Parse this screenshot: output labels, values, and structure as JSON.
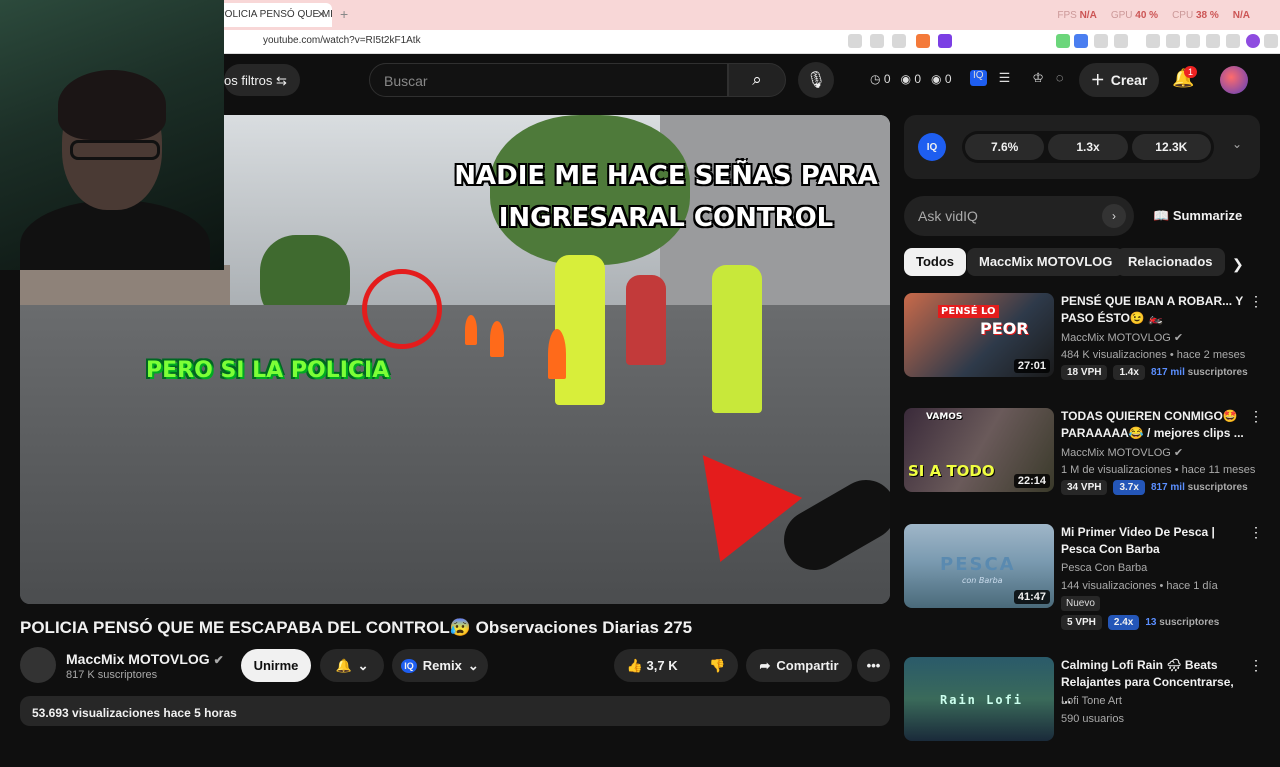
{
  "browser": {
    "tab_title": "POLICIA PENSÓ QUE ME",
    "url": "youtube.com/watch?v=RI5t2kF1Atk",
    "perf": {
      "fps_label": "FPS",
      "fps": "N/A",
      "gpu_label": "GPU",
      "gpu": "40 %",
      "cpu_label": "CPU",
      "cpu": "38 %",
      "extra": "N/A"
    }
  },
  "header": {
    "filters_label": "os filtros",
    "search_placeholder": "Buscar",
    "stat1": "0",
    "stat2": "0",
    "stat3": "0",
    "create_label": "Crear",
    "notif_count": "1"
  },
  "video": {
    "overlay_line1": "NADIE ME HACE SEÑAS PARA",
    "overlay_line2": "INGRESARAL CONTROL",
    "overlay_green": "PERO SI LA POLICIA",
    "title": "POLICIA PENSÓ QUE ME ESCAPABA DEL CONTROL😰 Observaciones Diarias 275",
    "channel": "MaccMix MOTOVLOG",
    "channel_subs": "817 K suscriptores",
    "subscribe": "Unirme",
    "remix": "Remix",
    "likes": "3,7 K",
    "share": "Compartir",
    "views_line": "53.693 visualizaciones  hace 5 horas"
  },
  "vidiq": {
    "logo": "IQ",
    "metrics": [
      "7.6%",
      "1.3x",
      "12.3K"
    ],
    "ask_placeholder": "Ask vidIQ",
    "summarize": "Summarize"
  },
  "chips": [
    "Todos",
    "MaccMix MOTOVLOG",
    "Relacionados"
  ],
  "recommendations": [
    {
      "title": "PENSÉ QUE IBAN A ROBAR... Y PASO ÉSTO😉 🏍️",
      "channel": "MaccMix MOTOVLOG",
      "meta": "484 K visualizaciones • hace 2 meses",
      "duration": "27:01",
      "vph": "18 VPH",
      "ratio": "1.4x",
      "subs_num": "817 mil",
      "subs_word": "suscriptores",
      "thumb_text": "PEOR",
      "thumb_text2": "PENSÉ LO"
    },
    {
      "title": "TODAS QUIEREN CONMIGO🤩 PARAAAAA😂 / mejores clips ...",
      "channel": "MaccMix MOTOVLOG",
      "meta": "1 M de visualizaciones • hace 11 meses",
      "duration": "22:14",
      "vph": "34 VPH",
      "ratio": "3.7x",
      "subs_num": "817 mil",
      "subs_word": "suscriptores",
      "thumb_text": "SI A TODO",
      "thumb_text2": "VAMOS"
    },
    {
      "title": "Mi Primer Video De Pesca | Pesca Con Barba",
      "channel": "Pesca Con Barba",
      "meta": "144 visualizaciones • hace 1 día",
      "duration": "41:47",
      "badge": "Nuevo",
      "vph": "5 VPH",
      "ratio": "2.4x",
      "subs_num": "13",
      "subs_word": "suscriptores",
      "thumb_text": "PESCA",
      "thumb_text2": "con Barba"
    },
    {
      "title": "Calming Lofi Rain 🌧 Beats Relajantes para Concentrarse, ...",
      "channel": "Lofi Tone Art",
      "meta": "590 usuarios",
      "thumb_text": "Rain Lofi"
    }
  ],
  "colors": {
    "accent": "#ff0000",
    "vidiq_blue": "#1e5ef0",
    "green_text": "#7cff37"
  }
}
